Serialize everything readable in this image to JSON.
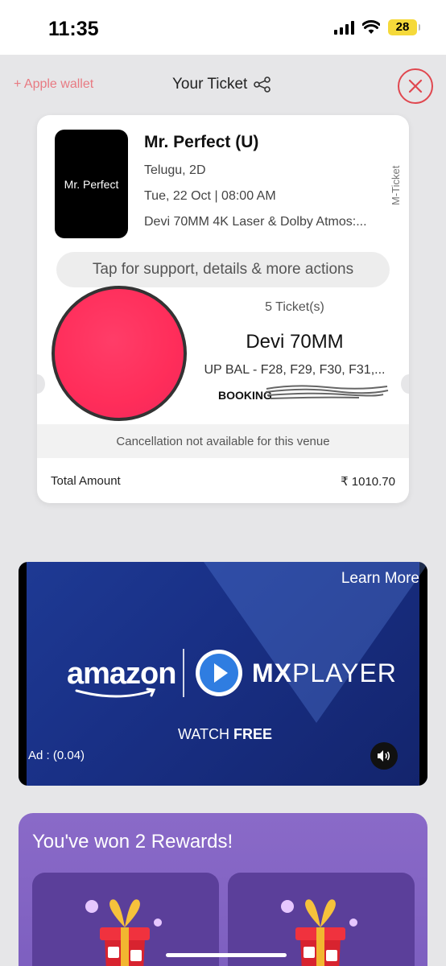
{
  "status_bar": {
    "time": "11:35",
    "battery": "28"
  },
  "header": {
    "apple_wallet": "+ Apple wallet",
    "title": "Your Ticket"
  },
  "ticket": {
    "poster_text": "Mr. Perfect",
    "title": "Mr. Perfect (U)",
    "language_format": "Telugu, 2D",
    "datetime": "Tue, 22 Oct | 08:00 AM",
    "venue": "Devi 70MM 4K Laser & Dolby Atmos:...",
    "m_ticket": "M-Ticket",
    "support_label": "Tap for support, details & more actions",
    "ticket_count": "5 Ticket(s)",
    "screen": "Devi 70MM",
    "seats": "UP BAL - F28, F29, F30, F31,...",
    "booking_id_label": "BOOKING",
    "cancellation_note": "Cancellation not available for this venue",
    "total_label": "Total Amount",
    "total_value": "₹ 1010.70"
  },
  "ad": {
    "learn_more": "Learn More",
    "brand_left": "amazon",
    "brand_right_bold": "MX",
    "brand_right_rest": "PLAYER",
    "watch": "WATCH",
    "free": "FREE",
    "timer": "Ad : (0.04)"
  },
  "rewards": {
    "title": "You've won 2 Rewards!"
  },
  "colors": {
    "accent_red": "#e0474f",
    "wallet_pink": "#e87a82",
    "redaction_pink": "#ff2d5a",
    "ad_blue": "#193086",
    "rewards_purple": "#8a6ac8"
  }
}
